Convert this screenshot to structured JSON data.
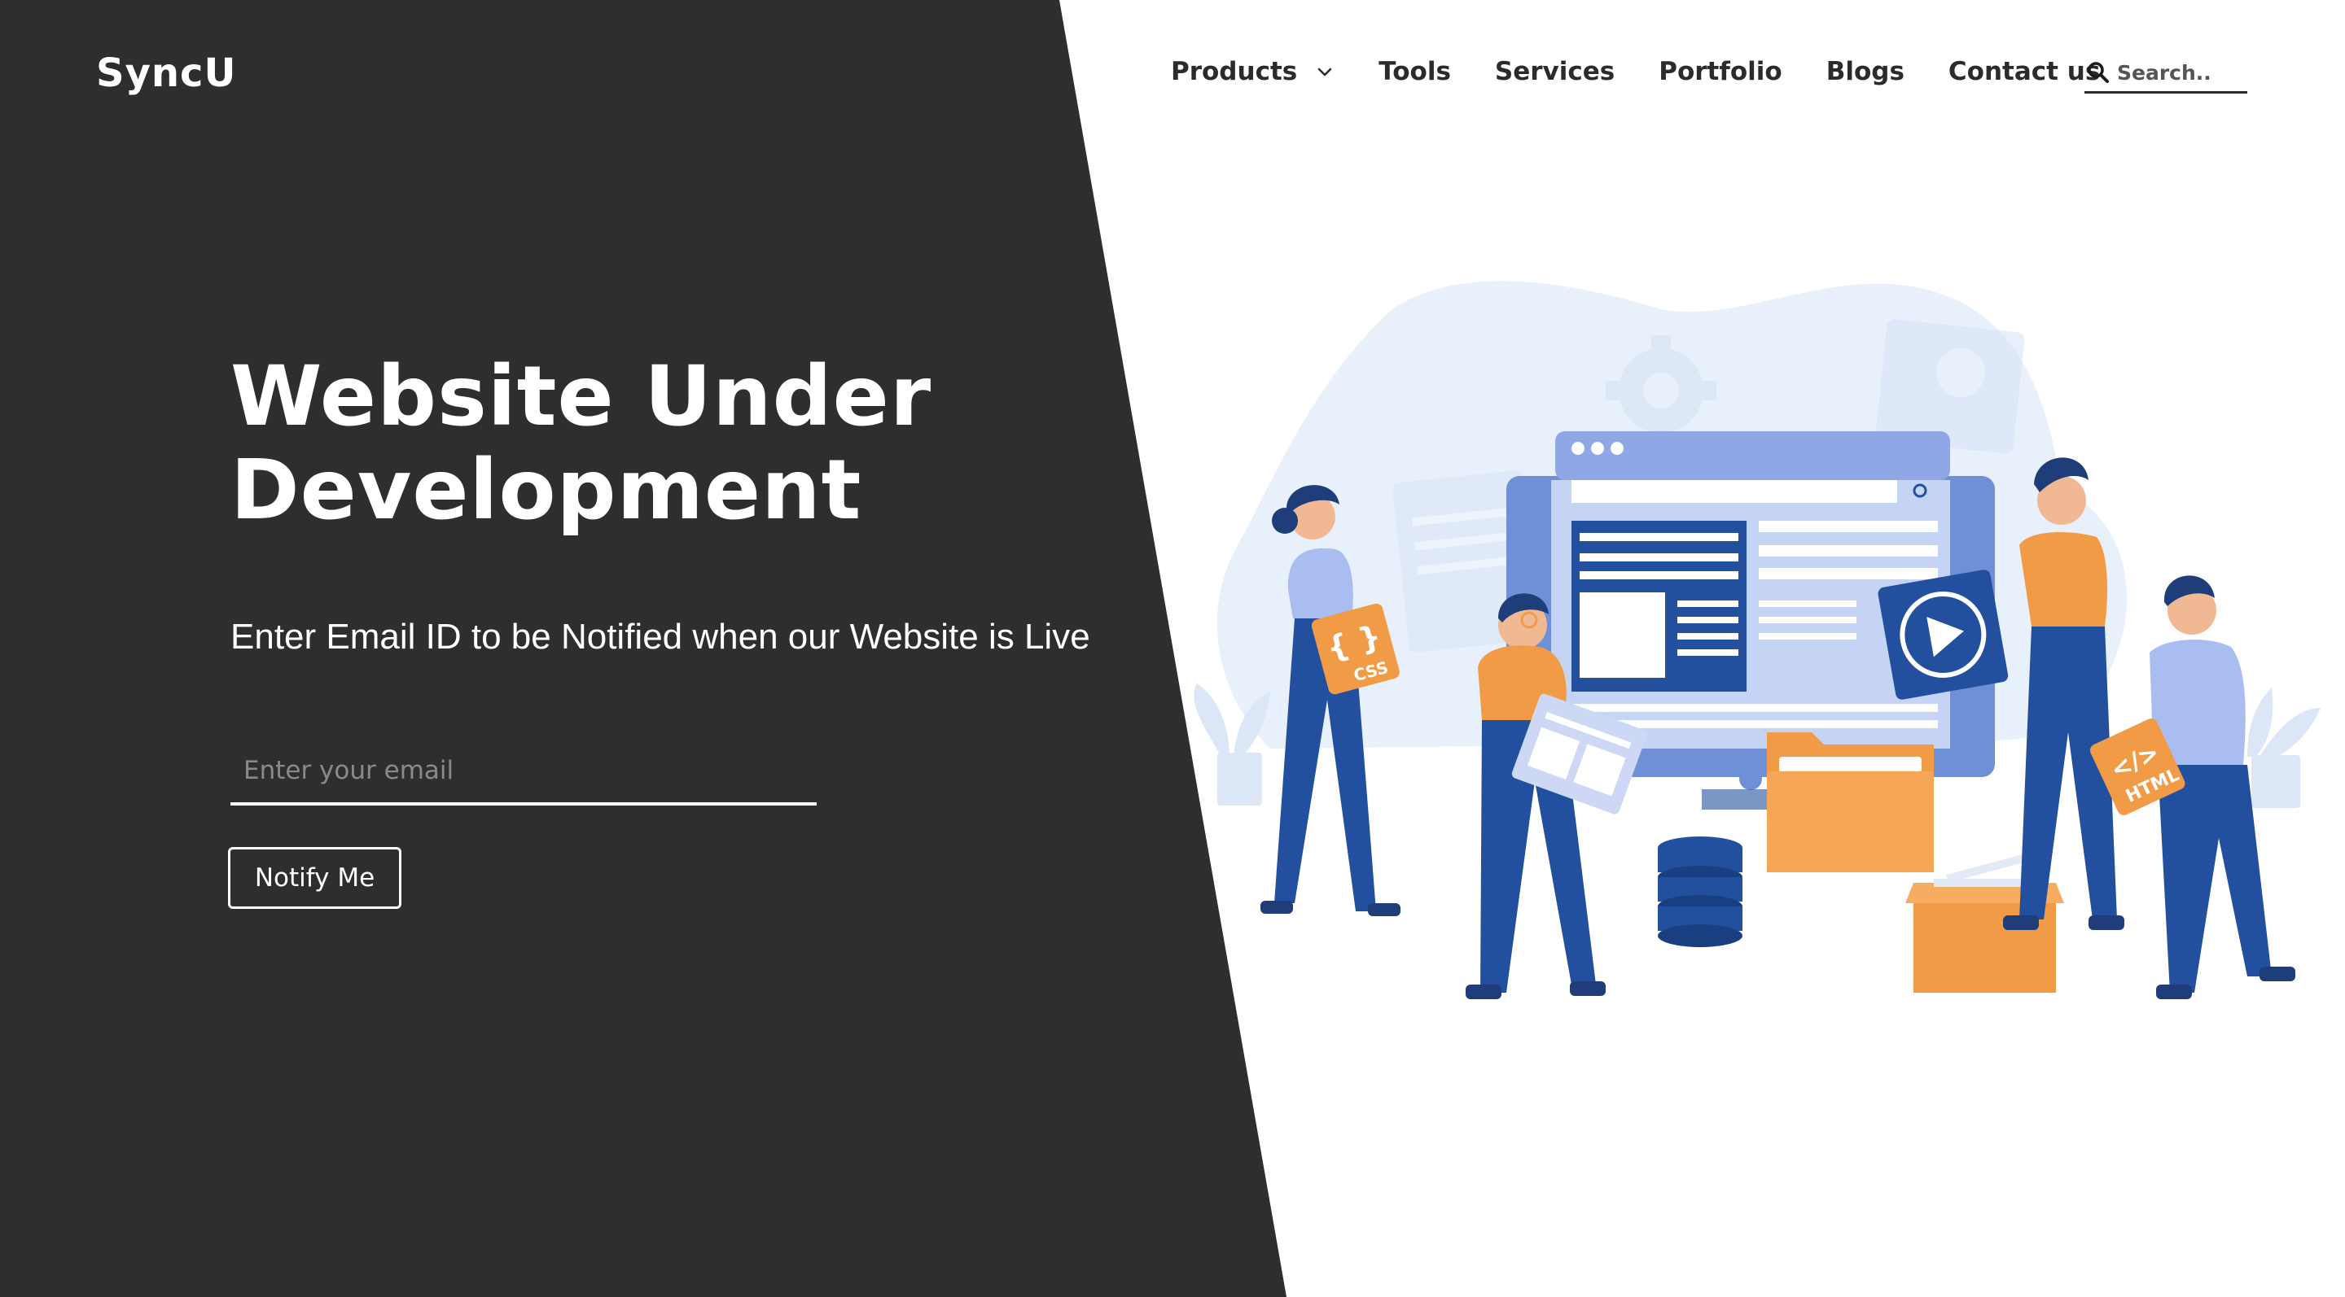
{
  "brand": {
    "logo_text": "SyncU"
  },
  "nav": {
    "items": [
      {
        "label": "Products",
        "has_dropdown": true
      },
      {
        "label": "Tools"
      },
      {
        "label": "Services"
      },
      {
        "label": "Portfolio"
      },
      {
        "label": "Blogs"
      },
      {
        "label": "Contact us"
      }
    ],
    "search_placeholder": "Search.."
  },
  "hero": {
    "headline_line1": "Website Under",
    "headline_line2": "Development",
    "subtitle": "Enter Email ID to be Notified when our Website is Live",
    "email_placeholder": "Enter your email",
    "notify_label": "Notify Me"
  },
  "illustration": {
    "css_tag": "CSS",
    "css_braces": "{ }",
    "html_tag": "HTML",
    "html_symbol": "</>"
  },
  "colors": {
    "dark_panel": "#2e2e2e",
    "accent_orange": "#f29b47",
    "accent_blue": "#22509e",
    "light_blue": "#a9bdf0",
    "pale_blue": "#e8f0fb"
  }
}
